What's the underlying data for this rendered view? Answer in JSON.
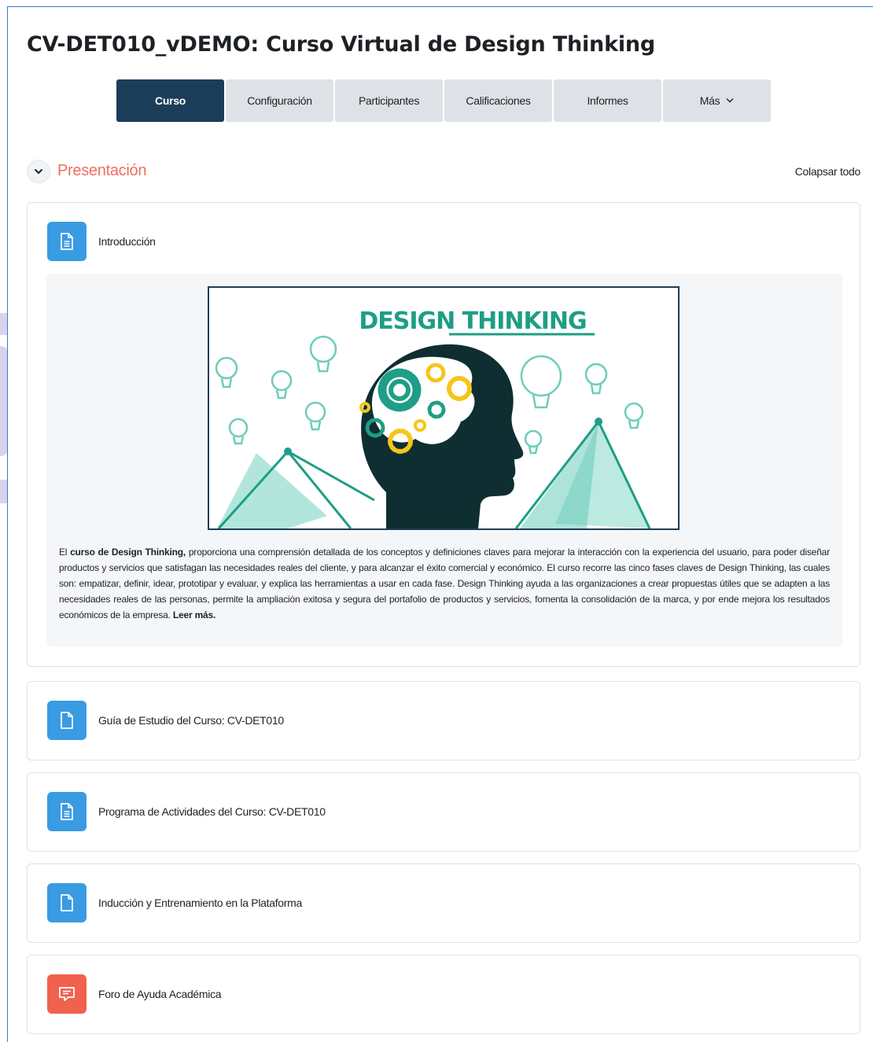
{
  "course": {
    "title": "CV-DET010_vDEMO: Curso Virtual de Design Thinking"
  },
  "tabs": [
    {
      "label": "Curso",
      "active": true
    },
    {
      "label": "Configuración",
      "active": false
    },
    {
      "label": "Participantes",
      "active": false
    },
    {
      "label": "Calificaciones",
      "active": false
    },
    {
      "label": "Informes",
      "active": false
    },
    {
      "label": "Más",
      "active": false,
      "icon": "chevron-down-icon"
    }
  ],
  "section": {
    "title": "Presentación",
    "collapse_icon": "chevron-down-icon",
    "collapse_all_label": "Colapsar todo"
  },
  "introduction": {
    "name": "Introducción",
    "icon": "page-icon",
    "banner_title": "DESIGN THINKING",
    "description": {
      "lead": "El ",
      "bold": "curso de Design Thinking,",
      "body": " proporciona una comprensión detallada de los conceptos y definiciones claves para mejorar la interacción con la experiencia del usuario, para poder diseñar productos y servicios que satisfagan las necesidades reales del cliente, y para alcanzar el éxito comercial y económico. El curso recorre las cinco fases claves de Design Thinking, las cuales son: empatizar, definir, idear, prototipar y evaluar, y explica las herramientas a usar en cada fase. Design Thinking ayuda a las organizaciones a crear propuestas útiles que se adapten a las necesidades reales de las personas, permite la ampliación exitosa y segura del portafolio de productos y servicios, fomenta la consolidación de la marca, y por ende mejora los resultados económicos de la empresa. ",
      "read_more": "Leer más."
    }
  },
  "activities": [
    {
      "name": "Guía de Estudio del Curso: CV-DET010",
      "icon": "file-icon",
      "color": "#399be2"
    },
    {
      "name": "Programa de Actividades del Curso: CV-DET010",
      "icon": "page-icon",
      "color": "#399be2"
    },
    {
      "name": "Inducción y Entrenamiento en la Plataforma",
      "icon": "file-icon",
      "color": "#399be2"
    },
    {
      "name": "Foro de Ayuda Académica",
      "icon": "forum-icon",
      "color": "#f0624d"
    }
  ],
  "colors": {
    "active_tab": "#1c3d5a",
    "tab_bg": "#dee2e6",
    "section_title": "#f06e5e",
    "activity_blue": "#399be2",
    "activity_red": "#f0624d",
    "banner_teal": "#1e9e86"
  }
}
